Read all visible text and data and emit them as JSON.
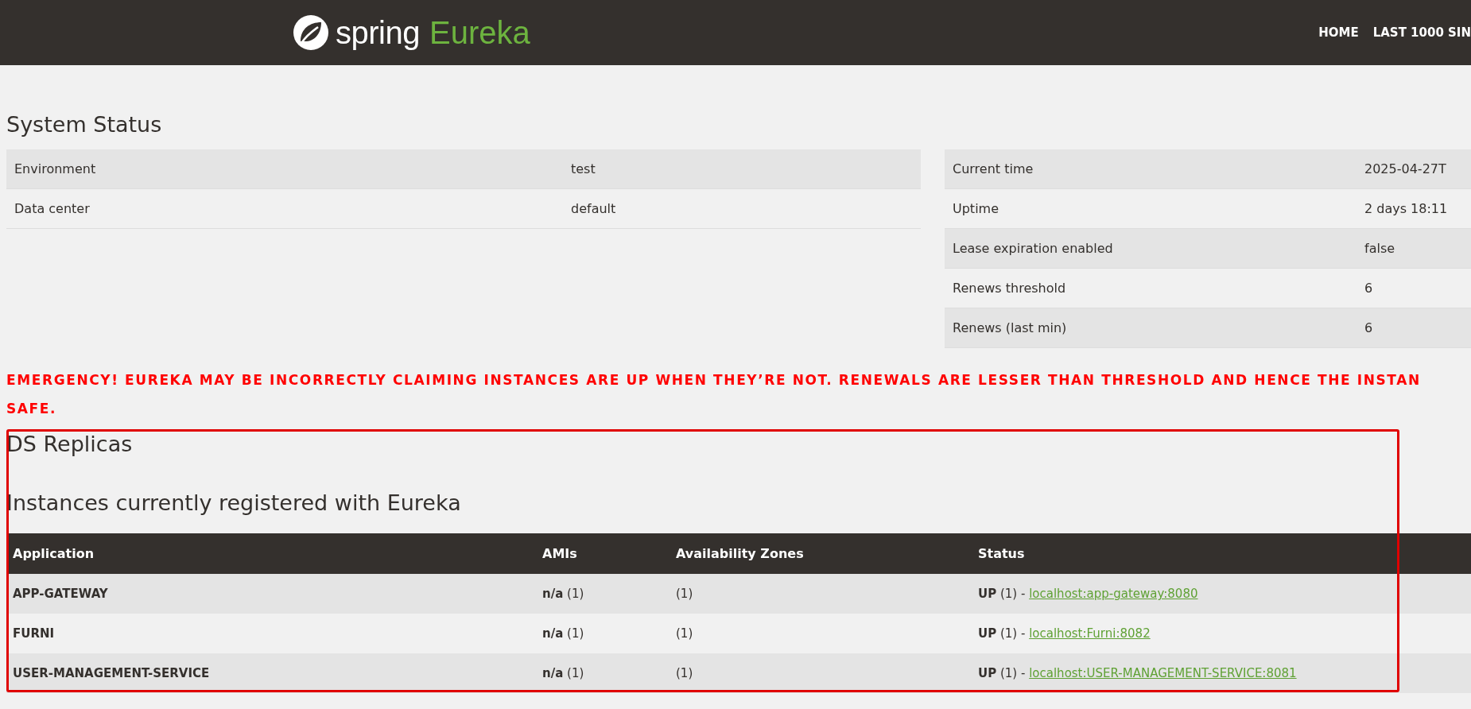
{
  "navbar": {
    "brand": "spring",
    "brand_product": "Eureka",
    "links": [
      "HOME",
      "LAST 1000 SIN"
    ]
  },
  "system_status": {
    "title": "System Status",
    "left": [
      {
        "label": "Environment",
        "value": "test"
      },
      {
        "label": "Data center",
        "value": "default"
      }
    ],
    "right": [
      {
        "label": "Current time",
        "value": "2025-04-27T"
      },
      {
        "label": "Uptime",
        "value": "2 days 18:11"
      },
      {
        "label": "Lease expiration enabled",
        "value": "false"
      },
      {
        "label": "Renews threshold",
        "value": "6"
      },
      {
        "label": "Renews (last min)",
        "value": "6"
      }
    ]
  },
  "emergency": [
    "EMERGENCY! EUREKA MAY BE INCORRECTLY CLAIMING INSTANCES ARE UP WHEN THEY’RE NOT. RENEWALS ARE LESSER THAN THRESHOLD AND HENCE THE INSTAN",
    "SAFE."
  ],
  "ds_replicas": {
    "title": "DS Replicas"
  },
  "instances": {
    "title": "Instances currently registered with Eureka",
    "columns": [
      "Application",
      "AMIs",
      "Availability Zones",
      "Status"
    ],
    "rows": [
      {
        "application": "APP-GATEWAY",
        "amis": "**n/a** (1)",
        "zones": "(1)",
        "status": "**UP** (1) -",
        "link": "localhost:app-gateway:8080"
      },
      {
        "application": "FURNI",
        "amis": "**n/a** (1)",
        "zones": "(1)",
        "status": "**UP** (1) -",
        "link": "localhost:Furni:8082"
      },
      {
        "application": "USER-MANAGEMENT-SERVICE",
        "amis": "**n/a** (1)",
        "zones": "(1)",
        "status": "**UP** (1) -",
        "link": "localhost:USER-MANAGEMENT-SERVICE:8081"
      }
    ]
  }
}
